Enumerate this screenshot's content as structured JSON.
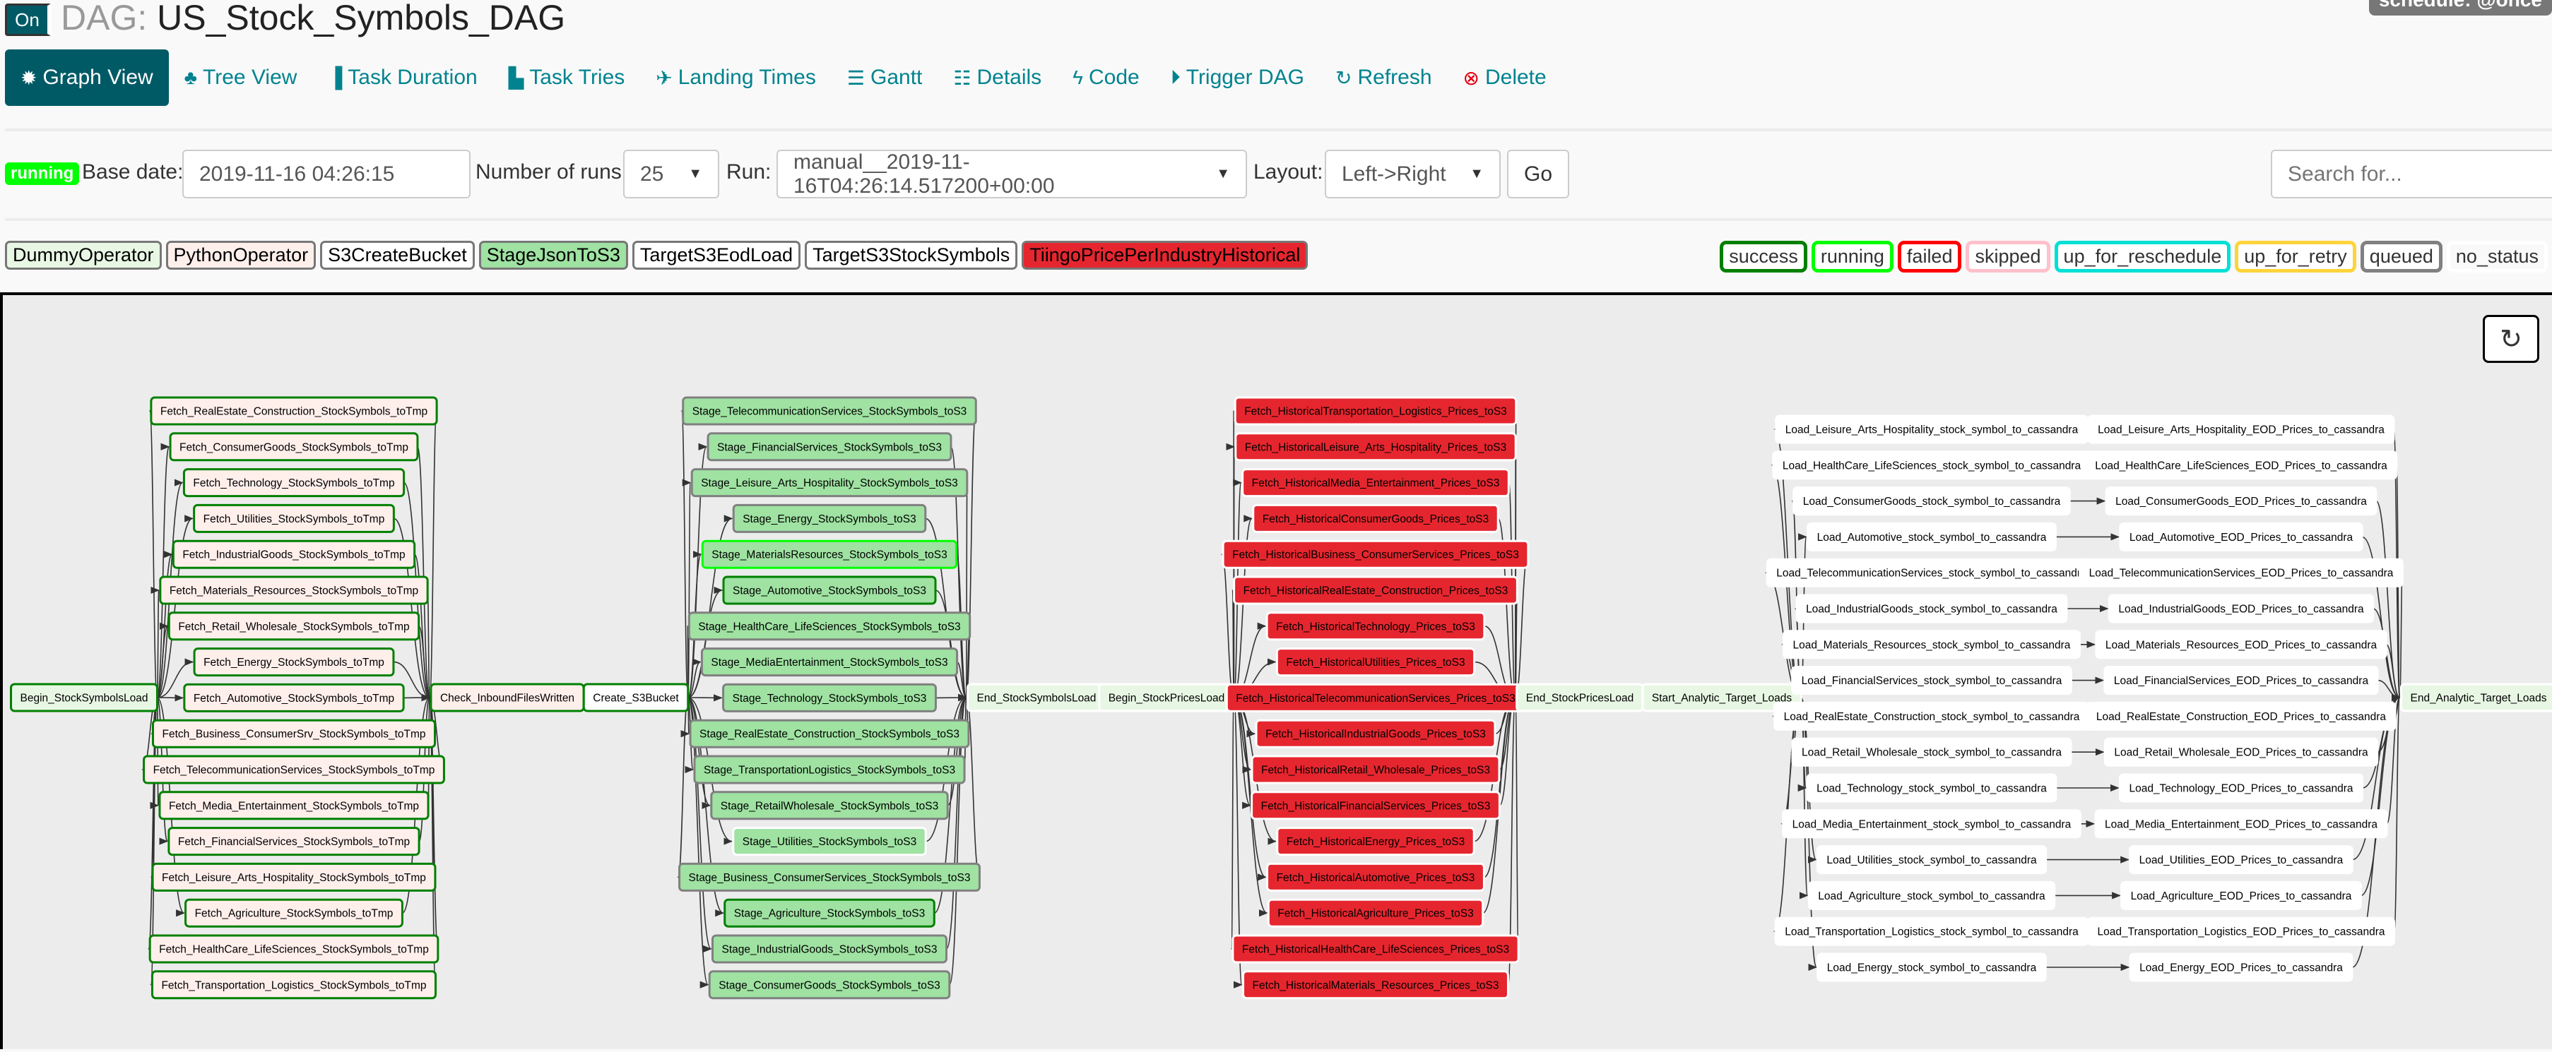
{
  "header": {
    "toggle_label": "On",
    "title_prefix": "DAG:",
    "dag_id": "US_Stock_Symbols_DAG",
    "schedule": "schedule: @once"
  },
  "nav": [
    {
      "label": "Graph View",
      "icon": "asterisk-icon",
      "glyph": "✹",
      "active": true
    },
    {
      "label": "Tree View",
      "icon": "tree-icon",
      "glyph": "♣"
    },
    {
      "label": "Task Duration",
      "icon": "bar-chart-icon",
      "glyph": "▐"
    },
    {
      "label": "Task Tries",
      "icon": "duplicate-icon",
      "glyph": "▙"
    },
    {
      "label": "Landing Times",
      "icon": "plane-icon",
      "glyph": "✈"
    },
    {
      "label": "Gantt",
      "icon": "align-left-icon",
      "glyph": "☰"
    },
    {
      "label": "Details",
      "icon": "list-icon",
      "glyph": "☷"
    },
    {
      "label": "Code",
      "icon": "flash-icon",
      "glyph": "ϟ"
    },
    {
      "label": "Trigger DAG",
      "icon": "play-circle-icon",
      "glyph": "⏵"
    },
    {
      "label": "Refresh",
      "icon": "refresh-icon",
      "glyph": "↻"
    },
    {
      "label": "Delete",
      "icon": "remove-circle-icon",
      "glyph": "⊗",
      "danger": true
    }
  ],
  "controls": {
    "state_badge": "running",
    "base_date_label": "Base date:",
    "base_date_value": "2019-11-16 04:26:15",
    "num_runs_label": "Number of runs:",
    "num_runs_value": "25",
    "run_label": "Run:",
    "run_value": "manual__2019-11-16T04:26:14.517200+00:00",
    "layout_label": "Layout:",
    "layout_value": "Left->Right",
    "go_label": "Go",
    "search_placeholder": "Search for..."
  },
  "operators": [
    {
      "name": "DummyOperator",
      "fill": "#e8f7e4"
    },
    {
      "name": "PythonOperator",
      "fill": "#ffefeb"
    },
    {
      "name": "S3CreateBucket",
      "fill": "#ffffff"
    },
    {
      "name": "StageJsonToS3",
      "fill": "#9fe2a2"
    },
    {
      "name": "TargetS3EodLoad",
      "fill": "#ffffff"
    },
    {
      "name": "TargetS3StockSymbols",
      "fill": "#ffffff"
    },
    {
      "name": "TiingoPricePerIndustryHistorical",
      "fill": "#e6262f"
    }
  ],
  "states": [
    {
      "name": "success",
      "color": "#008000"
    },
    {
      "name": "running",
      "color": "#00ff00"
    },
    {
      "name": "failed",
      "color": "#ff0000"
    },
    {
      "name": "skipped",
      "color": "#ffc0cb"
    },
    {
      "name": "up_for_reschedule",
      "color": "#00e0d6"
    },
    {
      "name": "up_for_retry",
      "color": "#ffd43b"
    },
    {
      "name": "queued",
      "color": "#808080"
    },
    {
      "name": "no_status",
      "color": "#ffffff"
    }
  ],
  "graph": {
    "refresh_icon": "refresh-icon",
    "begin_symbols": {
      "task": "Begin_StockSymbolsLoad",
      "op": "DummyOperator",
      "state": "success"
    },
    "fetch_symbols": [
      {
        "task": "Fetch_RealEstate_Construction_StockSymbols_toTmp",
        "op": "PythonOperator",
        "state": "success"
      },
      {
        "task": "Fetch_ConsumerGoods_StockSymbols_toTmp",
        "op": "PythonOperator",
        "state": "success"
      },
      {
        "task": "Fetch_Technology_StockSymbols_toTmp",
        "op": "PythonOperator",
        "state": "success"
      },
      {
        "task": "Fetch_Utilities_StockSymbols_toTmp",
        "op": "PythonOperator",
        "state": "success"
      },
      {
        "task": "Fetch_IndustrialGoods_StockSymbols_toTmp",
        "op": "PythonOperator",
        "state": "success"
      },
      {
        "task": "Fetch_Materials_Resources_StockSymbols_toTmp",
        "op": "PythonOperator",
        "state": "success"
      },
      {
        "task": "Fetch_Retail_Wholesale_StockSymbols_toTmp",
        "op": "PythonOperator",
        "state": "success"
      },
      {
        "task": "Fetch_Energy_StockSymbols_toTmp",
        "op": "PythonOperator",
        "state": "success"
      },
      {
        "task": "Fetch_Automotive_StockSymbols_toTmp",
        "op": "PythonOperator",
        "state": "success"
      },
      {
        "task": "Fetch_Business_ConsumerSrv_StockSymbols_toTmp",
        "op": "PythonOperator",
        "state": "success"
      },
      {
        "task": "Fetch_TelecommunicationServices_StockSymbols_toTmp",
        "op": "PythonOperator",
        "state": "success"
      },
      {
        "task": "Fetch_Media_Entertainment_StockSymbols_toTmp",
        "op": "PythonOperator",
        "state": "success"
      },
      {
        "task": "Fetch_FinancialServices_StockSymbols_toTmp",
        "op": "PythonOperator",
        "state": "success"
      },
      {
        "task": "Fetch_Leisure_Arts_Hospitality_StockSymbols_toTmp",
        "op": "PythonOperator",
        "state": "success"
      },
      {
        "task": "Fetch_Agriculture_StockSymbols_toTmp",
        "op": "PythonOperator",
        "state": "success"
      },
      {
        "task": "Fetch_HealthCare_LifeSciences_StockSymbols_toTmp",
        "op": "PythonOperator",
        "state": "success"
      },
      {
        "task": "Fetch_Transportation_Logistics_StockSymbols_toTmp",
        "op": "PythonOperator",
        "state": "success"
      }
    ],
    "check_files": {
      "task": "Check_InboundFilesWritten",
      "op": "PythonOperator",
      "state": "success"
    },
    "create_bucket": {
      "task": "Create_S3Bucket",
      "op": "S3CreateBucket",
      "state": "success"
    },
    "stage": [
      {
        "task": "Stage_TelecommunicationServices_StockSymbols_toS3",
        "op": "StageJsonToS3",
        "state": "queued"
      },
      {
        "task": "Stage_FinancialServices_StockSymbols_toS3",
        "op": "StageJsonToS3",
        "state": "queued"
      },
      {
        "task": "Stage_Leisure_Arts_Hospitality_StockSymbols_toS3",
        "op": "StageJsonToS3",
        "state": "queued"
      },
      {
        "task": "Stage_Energy_StockSymbols_toS3",
        "op": "StageJsonToS3",
        "state": "queued"
      },
      {
        "task": "Stage_MaterialsResources_StockSymbols_toS3",
        "op": "StageJsonToS3",
        "state": "running"
      },
      {
        "task": "Stage_Automotive_StockSymbols_toS3",
        "op": "StageJsonToS3",
        "state": "success"
      },
      {
        "task": "Stage_HealthCare_LifeSciences_StockSymbols_toS3",
        "op": "StageJsonToS3",
        "state": "queued"
      },
      {
        "task": "Stage_MediaEntertainment_StockSymbols_toS3",
        "op": "StageJsonToS3",
        "state": "queued"
      },
      {
        "task": "Stage_Technology_StockSymbols_toS3",
        "op": "StageJsonToS3",
        "state": "queued"
      },
      {
        "task": "Stage_RealEstate_Construction_StockSymbols_toS3",
        "op": "StageJsonToS3",
        "state": "queued"
      },
      {
        "task": "Stage_TransportationLogistics_StockSymbols_toS3",
        "op": "StageJsonToS3",
        "state": "queued"
      },
      {
        "task": "Stage_RetailWholesale_StockSymbols_toS3",
        "op": "StageJsonToS3",
        "state": "queued"
      },
      {
        "task": "Stage_Utilities_StockSymbols_toS3",
        "op": "StageJsonToS3",
        "state": "no_status"
      },
      {
        "task": "Stage_Business_ConsumerServices_StockSymbols_toS3",
        "op": "StageJsonToS3",
        "state": "queued"
      },
      {
        "task": "Stage_Agriculture_StockSymbols_toS3",
        "op": "StageJsonToS3",
        "state": "success"
      },
      {
        "task": "Stage_IndustrialGoods_StockSymbols_toS3",
        "op": "StageJsonToS3",
        "state": "queued"
      },
      {
        "task": "Stage_ConsumerGoods_StockSymbols_toS3",
        "op": "StageJsonToS3",
        "state": "queued"
      }
    ],
    "end_symbols": {
      "task": "End_StockSymbolsLoad",
      "op": "DummyOperator",
      "state": "no_status"
    },
    "begin_prices": {
      "task": "Begin_StockPricesLoad",
      "op": "DummyOperator",
      "state": "no_status"
    },
    "historical": [
      {
        "task": "Fetch_HistoricalTransportation_Logistics_Prices_toS3",
        "op": "TiingoPricePerIndustryHistorical",
        "state": "no_status"
      },
      {
        "task": "Fetch_HistoricalLeisure_Arts_Hospitality_Prices_toS3",
        "op": "TiingoPricePerIndustryHistorical",
        "state": "no_status"
      },
      {
        "task": "Fetch_HistoricalMedia_Entertainment_Prices_toS3",
        "op": "TiingoPricePerIndustryHistorical",
        "state": "no_status"
      },
      {
        "task": "Fetch_HistoricalConsumerGoods_Prices_toS3",
        "op": "TiingoPricePerIndustryHistorical",
        "state": "no_status"
      },
      {
        "task": "Fetch_HistoricalBusiness_ConsumerServices_Prices_toS3",
        "op": "TiingoPricePerIndustryHistorical",
        "state": "no_status"
      },
      {
        "task": "Fetch_HistoricalRealEstate_Construction_Prices_toS3",
        "op": "TiingoPricePerIndustryHistorical",
        "state": "no_status"
      },
      {
        "task": "Fetch_HistoricalTechnology_Prices_toS3",
        "op": "TiingoPricePerIndustryHistorical",
        "state": "no_status"
      },
      {
        "task": "Fetch_HistoricalUtilities_Prices_toS3",
        "op": "TiingoPricePerIndustryHistorical",
        "state": "no_status"
      },
      {
        "task": "Fetch_HistoricalTelecommunicationServices_Prices_toS3",
        "op": "TiingoPricePerIndustryHistorical",
        "state": "no_status"
      },
      {
        "task": "Fetch_HistoricalIndustrialGoods_Prices_toS3",
        "op": "TiingoPricePerIndustryHistorical",
        "state": "no_status"
      },
      {
        "task": "Fetch_HistoricalRetail_Wholesale_Prices_toS3",
        "op": "TiingoPricePerIndustryHistorical",
        "state": "no_status"
      },
      {
        "task": "Fetch_HistoricalFinancialServices_Prices_toS3",
        "op": "TiingoPricePerIndustryHistorical",
        "state": "no_status"
      },
      {
        "task": "Fetch_HistoricalEnergy_Prices_toS3",
        "op": "TiingoPricePerIndustryHistorical",
        "state": "no_status"
      },
      {
        "task": "Fetch_HistoricalAutomotive_Prices_toS3",
        "op": "TiingoPricePerIndustryHistorical",
        "state": "no_status"
      },
      {
        "task": "Fetch_HistoricalAgriculture_Prices_toS3",
        "op": "TiingoPricePerIndustryHistorical",
        "state": "no_status"
      },
      {
        "task": "Fetch_HistoricalHealthCare_LifeSciences_Prices_toS3",
        "op": "TiingoPricePerIndustryHistorical",
        "state": "no_status"
      },
      {
        "task": "Fetch_HistoricalMaterials_Resources_Prices_toS3",
        "op": "TiingoPricePerIndustryHistorical",
        "state": "no_status"
      }
    ],
    "end_prices": {
      "task": "End_StockPricesLoad",
      "op": "DummyOperator",
      "state": "no_status"
    },
    "start_analytic": {
      "task": "Start_Analytic_Target_Loads",
      "op": "DummyOperator",
      "state": "no_status"
    },
    "industries": [
      "Leisure_Arts_Hospitality",
      "HealthCare_LifeSciences",
      "ConsumerGoods",
      "Automotive",
      "TelecommunicationServices",
      "IndustrialGoods",
      "Materials_Resources",
      "FinancialServices",
      "RealEstate_Construction",
      "Retail_Wholesale",
      "Technology",
      "Media_Entertainment",
      "Utilities",
      "Agriculture",
      "Transportation_Logistics",
      "Energy"
    ],
    "load_symbols": [
      {
        "task": "Load_Leisure_Arts_Hospitality_stock_symbol_to_cassandra",
        "op": "TargetS3StockSymbols",
        "state": "no_status"
      },
      {
        "task": "Load_HealthCare_LifeSciences_stock_symbol_to_cassandra",
        "op": "TargetS3StockSymbols",
        "state": "no_status"
      },
      {
        "task": "Load_ConsumerGoods_stock_symbol_to_cassandra",
        "op": "TargetS3StockSymbols",
        "state": "no_status"
      },
      {
        "task": "Load_Automotive_stock_symbol_to_cassandra",
        "op": "TargetS3StockSymbols",
        "state": "no_status"
      },
      {
        "task": "Load_TelecommunicationServices_stock_symbol_to_cassandra",
        "op": "TargetS3StockSymbols",
        "state": "no_status"
      },
      {
        "task": "Load_IndustrialGoods_stock_symbol_to_cassandra",
        "op": "TargetS3StockSymbols",
        "state": "no_status"
      },
      {
        "task": "Load_Materials_Resources_stock_symbol_to_cassandra",
        "op": "TargetS3StockSymbols",
        "state": "no_status"
      },
      {
        "task": "Load_FinancialServices_stock_symbol_to_cassandra",
        "op": "TargetS3StockSymbols",
        "state": "no_status"
      },
      {
        "task": "Load_RealEstate_Construction_stock_symbol_to_cassandra",
        "op": "TargetS3StockSymbols",
        "state": "no_status"
      },
      {
        "task": "Load_Retail_Wholesale_stock_symbol_to_cassandra",
        "op": "TargetS3StockSymbols",
        "state": "no_status"
      },
      {
        "task": "Load_Technology_stock_symbol_to_cassandra",
        "op": "TargetS3StockSymbols",
        "state": "no_status"
      },
      {
        "task": "Load_Media_Entertainment_stock_symbol_to_cassandra",
        "op": "TargetS3StockSymbols",
        "state": "no_status"
      },
      {
        "task": "Load_Utilities_stock_symbol_to_cassandra",
        "op": "TargetS3StockSymbols",
        "state": "no_status"
      },
      {
        "task": "Load_Agriculture_stock_symbol_to_cassandra",
        "op": "TargetS3StockSymbols",
        "state": "no_status"
      },
      {
        "task": "Load_Transportation_Logistics_stock_symbol_to_cassandra",
        "op": "TargetS3StockSymbols",
        "state": "no_status"
      },
      {
        "task": "Load_Energy_stock_symbol_to_cassandra",
        "op": "TargetS3StockSymbols",
        "state": "no_status"
      }
    ],
    "load_eod": [
      {
        "task": "Load_Leisure_Arts_Hospitality_EOD_Prices_to_cassandra",
        "op": "TargetS3EodLoad",
        "state": "no_status"
      },
      {
        "task": "Load_HealthCare_LifeSciences_EOD_Prices_to_cassandra",
        "op": "TargetS3EodLoad",
        "state": "no_status"
      },
      {
        "task": "Load_ConsumerGoods_EOD_Prices_to_cassandra",
        "op": "TargetS3EodLoad",
        "state": "no_status"
      },
      {
        "task": "Load_Automotive_EOD_Prices_to_cassandra",
        "op": "TargetS3EodLoad",
        "state": "no_status"
      },
      {
        "task": "Load_TelecommunicationServices_EOD_Prices_to_cassandra",
        "op": "TargetS3EodLoad",
        "state": "no_status"
      },
      {
        "task": "Load_IndustrialGoods_EOD_Prices_to_cassandra",
        "op": "TargetS3EodLoad",
        "state": "no_status"
      },
      {
        "task": "Load_Materials_Resources_EOD_Prices_to_cassandra",
        "op": "TargetS3EodLoad",
        "state": "no_status"
      },
      {
        "task": "Load_FinancialServices_EOD_Prices_to_cassandra",
        "op": "TargetS3EodLoad",
        "state": "no_status"
      },
      {
        "task": "Load_RealEstate_Construction_EOD_Prices_to_cassandra",
        "op": "TargetS3EodLoad",
        "state": "no_status"
      },
      {
        "task": "Load_Retail_Wholesale_EOD_Prices_to_cassandra",
        "op": "TargetS3EodLoad",
        "state": "no_status"
      },
      {
        "task": "Load_Technology_EOD_Prices_to_cassandra",
        "op": "TargetS3EodLoad",
        "state": "no_status"
      },
      {
        "task": "Load_Media_Entertainment_EOD_Prices_to_cassandra",
        "op": "TargetS3EodLoad",
        "state": "no_status"
      },
      {
        "task": "Load_Utilities_EOD_Prices_to_cassandra",
        "op": "TargetS3EodLoad",
        "state": "no_status"
      },
      {
        "task": "Load_Agriculture_EOD_Prices_to_cassandra",
        "op": "TargetS3EodLoad",
        "state": "no_status"
      },
      {
        "task": "Load_Transportation_Logistics_EOD_Prices_to_cassandra",
        "op": "TargetS3EodLoad",
        "state": "no_status"
      },
      {
        "task": "Load_Energy_EOD_Prices_to_cassandra",
        "op": "TargetS3EodLoad",
        "state": "no_status"
      }
    ],
    "end_analytic": {
      "task": "End_Analytic_Target_Loads",
      "op": "DummyOperator",
      "state": "no_status"
    }
  }
}
